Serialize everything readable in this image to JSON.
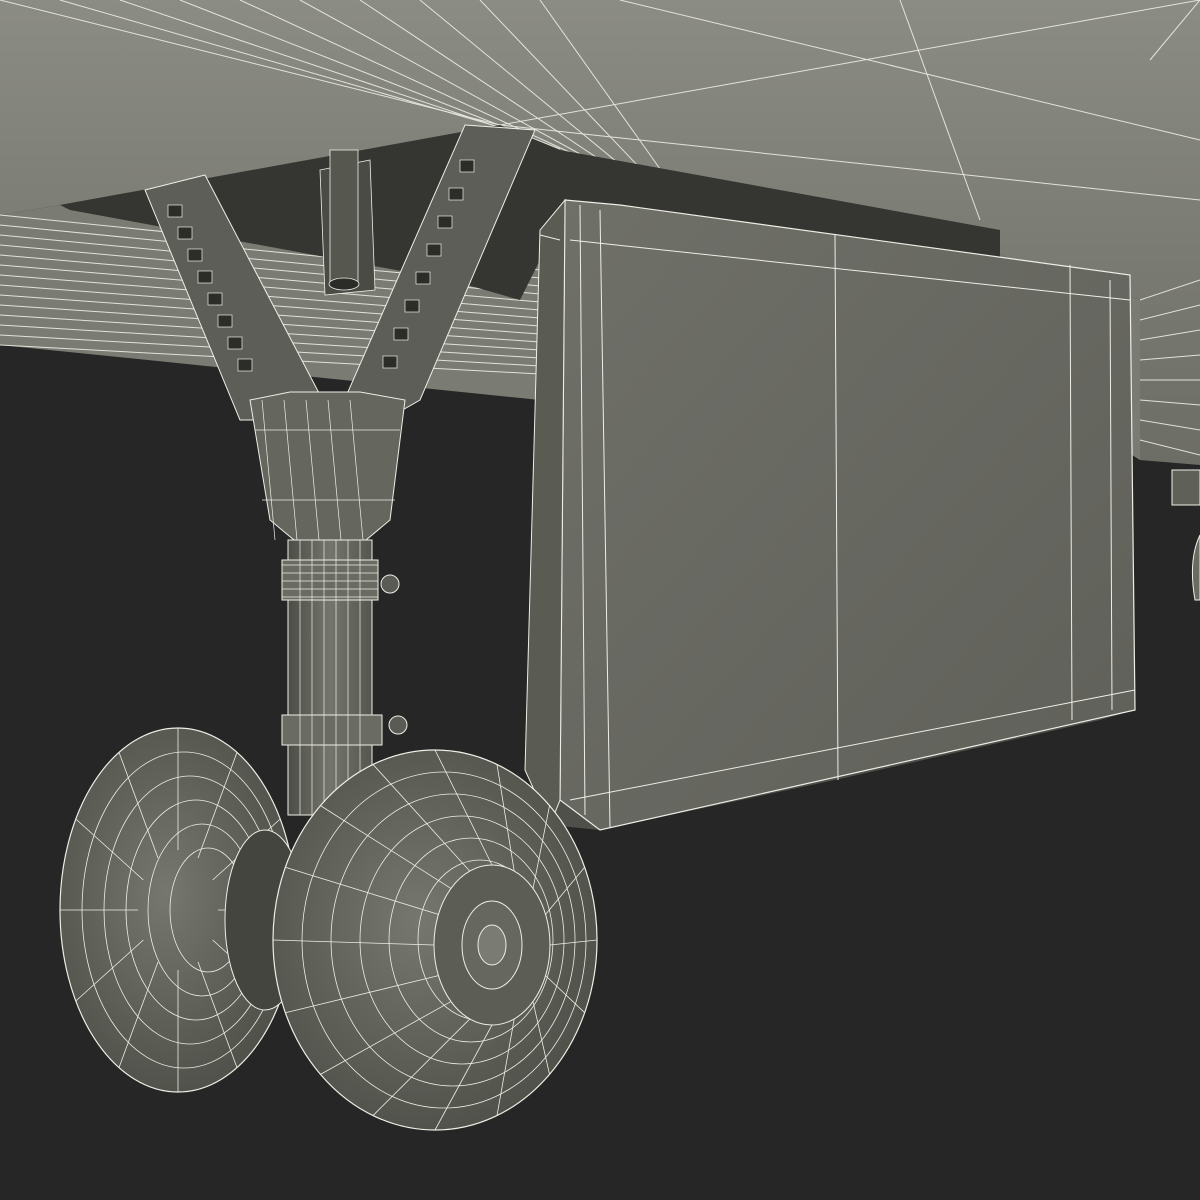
{
  "scene": {
    "subject": "aircraft-nose-landing-gear-wireframe",
    "render_style": "wireframe",
    "colors": {
      "background": "#262626",
      "surface": "#6e6f66",
      "surface_dark": "#56574f",
      "surface_light": "#878880",
      "wire": "#eeeee6",
      "shadow": "#1e1f1c"
    },
    "components": [
      "fuselage-underside",
      "wheel-well",
      "drag-brace",
      "oleo-strut",
      "gear-door",
      "left-tire",
      "right-tire",
      "wheel-hub"
    ]
  }
}
